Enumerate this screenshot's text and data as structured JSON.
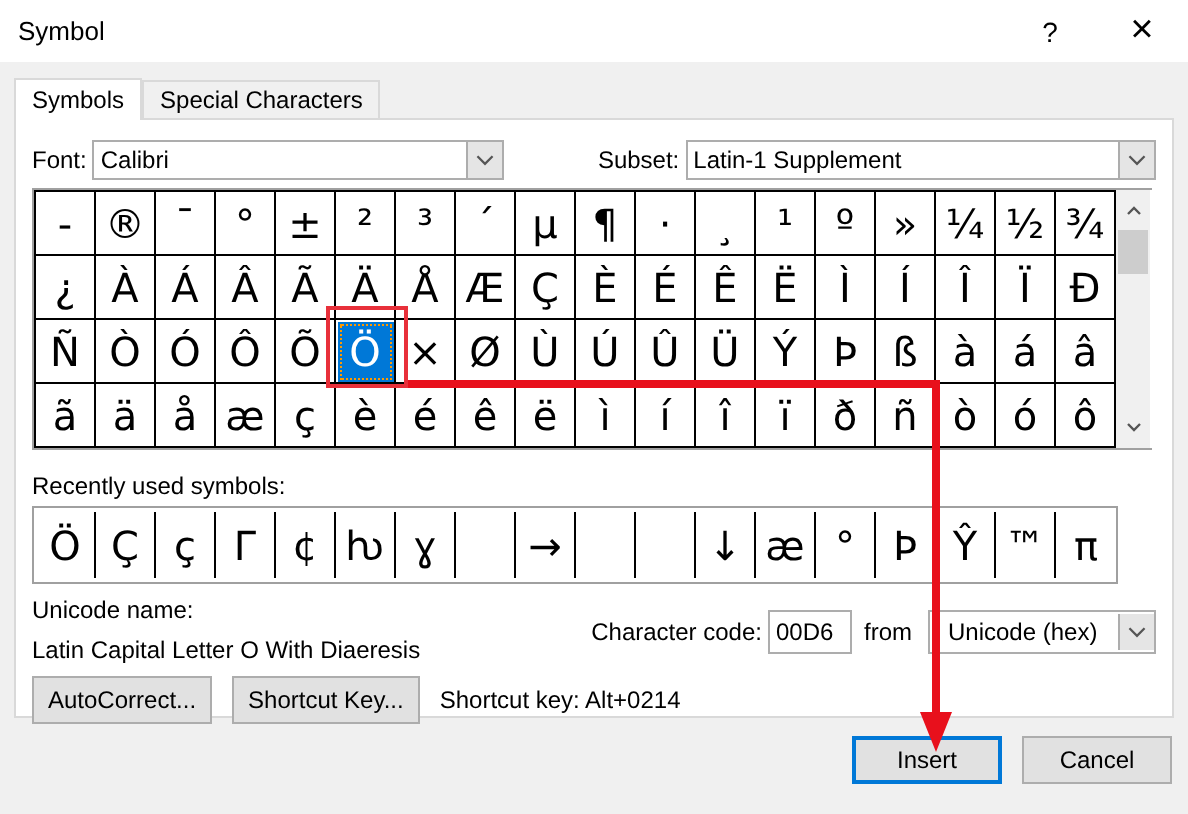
{
  "window": {
    "title": "Symbol",
    "help": "?",
    "close": "×"
  },
  "tabs": [
    {
      "label": "Symbols",
      "selected": true
    },
    {
      "label": "Special Characters",
      "selected": false
    }
  ],
  "font": {
    "label": "Font:",
    "value": "Calibri"
  },
  "subset": {
    "label": "Subset:",
    "value": "Latin-1 Supplement"
  },
  "grid": [
    {
      "cells": [
        {
          "symbol": "-",
          "selected": false
        },
        {
          "symbol": "®",
          "selected": false
        },
        {
          "symbol": "¯",
          "selected": false
        },
        {
          "symbol": "°",
          "selected": false
        },
        {
          "symbol": "±",
          "selected": false
        },
        {
          "symbol": "²",
          "selected": false
        },
        {
          "symbol": "³",
          "selected": false
        },
        {
          "symbol": "´",
          "selected": false
        },
        {
          "symbol": "µ",
          "selected": false
        },
        {
          "symbol": "¶",
          "selected": false
        },
        {
          "symbol": "·",
          "selected": false
        },
        {
          "symbol": "¸",
          "selected": false
        },
        {
          "symbol": "¹",
          "selected": false
        },
        {
          "symbol": "º",
          "selected": false
        },
        {
          "symbol": "»",
          "selected": false
        },
        {
          "symbol": "¼",
          "selected": false
        },
        {
          "symbol": "½",
          "selected": false
        },
        {
          "symbol": "¾",
          "selected": false
        }
      ]
    },
    {
      "cells": [
        {
          "symbol": "¿",
          "selected": false
        },
        {
          "symbol": "À",
          "selected": false
        },
        {
          "symbol": "Á",
          "selected": false
        },
        {
          "symbol": "Â",
          "selected": false
        },
        {
          "symbol": "Ã",
          "selected": false
        },
        {
          "symbol": "Ä",
          "selected": false
        },
        {
          "symbol": "Å",
          "selected": false
        },
        {
          "symbol": "Æ",
          "selected": false
        },
        {
          "symbol": "Ç",
          "selected": false
        },
        {
          "symbol": "È",
          "selected": false
        },
        {
          "symbol": "É",
          "selected": false
        },
        {
          "symbol": "Ê",
          "selected": false
        },
        {
          "symbol": "Ë",
          "selected": false
        },
        {
          "symbol": "Ì",
          "selected": false
        },
        {
          "symbol": "Í",
          "selected": false
        },
        {
          "symbol": "Î",
          "selected": false
        },
        {
          "symbol": "Ï",
          "selected": false
        },
        {
          "symbol": "Ð",
          "selected": false
        }
      ]
    },
    {
      "cells": [
        {
          "symbol": "Ñ",
          "selected": false
        },
        {
          "symbol": "Ò",
          "selected": false
        },
        {
          "symbol": "Ó",
          "selected": false
        },
        {
          "symbol": "Ô",
          "selected": false
        },
        {
          "symbol": "Õ",
          "selected": false
        },
        {
          "symbol": "Ö",
          "selected": true
        },
        {
          "symbol": "×",
          "selected": false
        },
        {
          "symbol": "Ø",
          "selected": false
        },
        {
          "symbol": "Ù",
          "selected": false
        },
        {
          "symbol": "Ú",
          "selected": false
        },
        {
          "symbol": "Û",
          "selected": false
        },
        {
          "symbol": "Ü",
          "selected": false
        },
        {
          "symbol": "Ý",
          "selected": false
        },
        {
          "symbol": "Þ",
          "selected": false
        },
        {
          "symbol": "ß",
          "selected": false
        },
        {
          "symbol": "à",
          "selected": false
        },
        {
          "symbol": "á",
          "selected": false
        },
        {
          "symbol": "â",
          "selected": false
        }
      ]
    },
    {
      "cells": [
        {
          "symbol": "ã",
          "selected": false
        },
        {
          "symbol": "ä",
          "selected": false
        },
        {
          "symbol": "å",
          "selected": false
        },
        {
          "symbol": "æ",
          "selected": false
        },
        {
          "symbol": "ç",
          "selected": false
        },
        {
          "symbol": "è",
          "selected": false
        },
        {
          "symbol": "é",
          "selected": false
        },
        {
          "symbol": "ê",
          "selected": false
        },
        {
          "symbol": "ë",
          "selected": false
        },
        {
          "symbol": "ì",
          "selected": false
        },
        {
          "symbol": "í",
          "selected": false
        },
        {
          "symbol": "î",
          "selected": false
        },
        {
          "symbol": "ï",
          "selected": false
        },
        {
          "symbol": "ð",
          "selected": false
        },
        {
          "symbol": "ñ",
          "selected": false
        },
        {
          "symbol": "ò",
          "selected": false
        },
        {
          "symbol": "ó",
          "selected": false
        },
        {
          "symbol": "ô",
          "selected": false
        }
      ]
    }
  ],
  "recent": {
    "label": "Recently used symbols:",
    "items": [
      {
        "kind": "glyph",
        "symbol": "Ö"
      },
      {
        "kind": "glyph",
        "symbol": "Ç"
      },
      {
        "kind": "glyph",
        "symbol": "ç"
      },
      {
        "kind": "glyph",
        "symbol": "Γ"
      },
      {
        "kind": "glyph",
        "symbol": "¢"
      },
      {
        "kind": "glyph",
        "symbol": "ƕ"
      },
      {
        "kind": "glyph",
        "symbol": "ɣ"
      },
      {
        "kind": "blank"
      },
      {
        "kind": "glyph",
        "symbol": "→"
      },
      {
        "kind": "blank"
      },
      {
        "kind": "blank"
      },
      {
        "kind": "glyph",
        "symbol": "↓"
      },
      {
        "kind": "glyph",
        "symbol": "æ"
      },
      {
        "kind": "glyph",
        "symbol": "°"
      },
      {
        "kind": "glyph",
        "symbol": "Þ"
      },
      {
        "kind": "glyph",
        "symbol": "Ŷ"
      },
      {
        "kind": "glyph",
        "symbol": "™"
      },
      {
        "kind": "glyph",
        "symbol": "π"
      }
    ]
  },
  "unicode_name": {
    "label": "Unicode name:",
    "value": "Latin Capital Letter O With Diaeresis"
  },
  "character_code": {
    "label": "Character code:",
    "value": "00D6"
  },
  "from": {
    "label": "from",
    "value": "Unicode (hex)"
  },
  "autocorrect_button": {
    "label": "AutoCorrect..."
  },
  "shortcut_key_button": {
    "label": "Shortcut Key..."
  },
  "shortcut_key_text": "Shortcut key: Alt+0214",
  "buttons": [
    {
      "label": "Insert",
      "default": true
    },
    {
      "label": "Cancel",
      "default": false
    }
  ]
}
